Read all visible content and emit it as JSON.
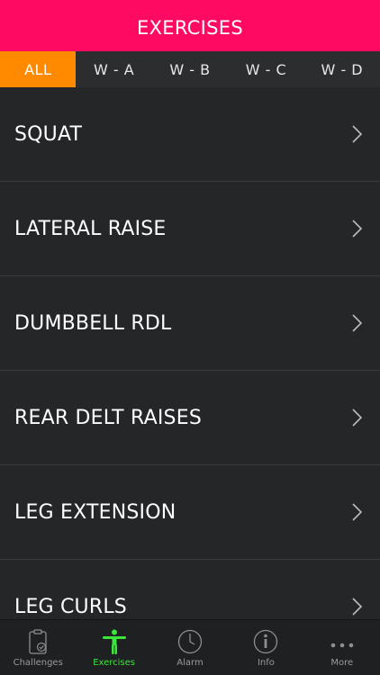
{
  "header": {
    "title": "EXERCISES"
  },
  "tabs": [
    {
      "label": "ALL",
      "active": true
    },
    {
      "label": "W - A",
      "active": false
    },
    {
      "label": "W - B",
      "active": false
    },
    {
      "label": "W - C",
      "active": false
    },
    {
      "label": "W - D",
      "active": false
    }
  ],
  "exercises": [
    {
      "label": "SQUAT"
    },
    {
      "label": "LATERAL RAISE"
    },
    {
      "label": "DUMBBELL RDL"
    },
    {
      "label": "REAR DELT RAISES"
    },
    {
      "label": "LEG EXTENSION"
    },
    {
      "label": "LEG CURLS"
    }
  ],
  "tabbar": {
    "items": [
      {
        "label": "Challenges",
        "icon": "clipboard-icon",
        "active": false
      },
      {
        "label": "Exercises",
        "icon": "person-icon",
        "active": true
      },
      {
        "label": "Alarm",
        "icon": "clock-icon",
        "active": false
      },
      {
        "label": "Info",
        "icon": "info-icon",
        "active": false
      },
      {
        "label": "More",
        "icon": "more-dots-icon",
        "active": false
      }
    ]
  },
  "colors": {
    "header": "#ff0a62",
    "active_tab": "#ff8a00",
    "active_tabbar": "#3de53a",
    "background": "#252628"
  }
}
